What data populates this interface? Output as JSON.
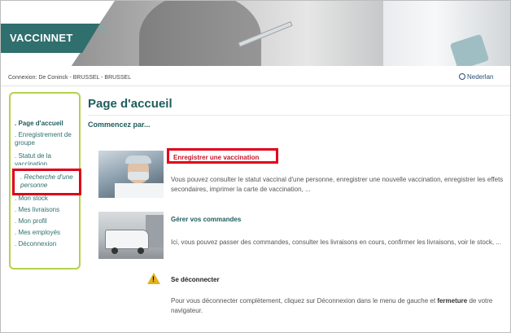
{
  "header": {
    "logo_text": "VACCINNET"
  },
  "top_bar": {
    "connection": "Connexion: De Coninck - BRUSSEL - BRUSSEL",
    "language": "Nederlan"
  },
  "sidebar": {
    "items": [
      {
        "label": ". Page d'accueil"
      },
      {
        "label": ". Enregistrement de groupe"
      },
      {
        "label": ". Statut de la vaccination"
      },
      {
        "label": ". Recherche d'une personne"
      },
      {
        "label": ". Mon stock"
      },
      {
        "label": ". Mes livraisons"
      },
      {
        "label": ". Mon profil"
      },
      {
        "label": ". Mes employés"
      },
      {
        "label": ". Déconnexion"
      }
    ]
  },
  "main": {
    "title": "Page d'accueil",
    "subtitle": "Commencez par...",
    "sections": [
      {
        "link": "Enregistrer une vaccination",
        "text": "Vous pouvez consulter le statut vaccinal d'une personne, enregistrer une nouvelle vaccination, enregistrer les effets secondaires, imprimer la carte de vaccination, ..."
      },
      {
        "link": "Gérer vos commandes",
        "text": "Ici, vous pouvez passer des commandes, consulter les livraisons en cours, confirmer les livraisons, voir le stock, ..."
      },
      {
        "link": "Se déconnecter",
        "text_before": "Pour vous déconnecter complètement, cliquez sur Déconnexion dans le menu de gauche et ",
        "text_bold": "fermeture",
        "text_after": " de votre navigateur."
      }
    ]
  },
  "colors": {
    "brand": "#2f6f6d",
    "sidebar_border": "#b5d24c",
    "highlight": "#e0001a",
    "warning": "#e3b21a"
  },
  "icons": {
    "language": "globe-icon",
    "logout": "warning-triangle-icon"
  }
}
